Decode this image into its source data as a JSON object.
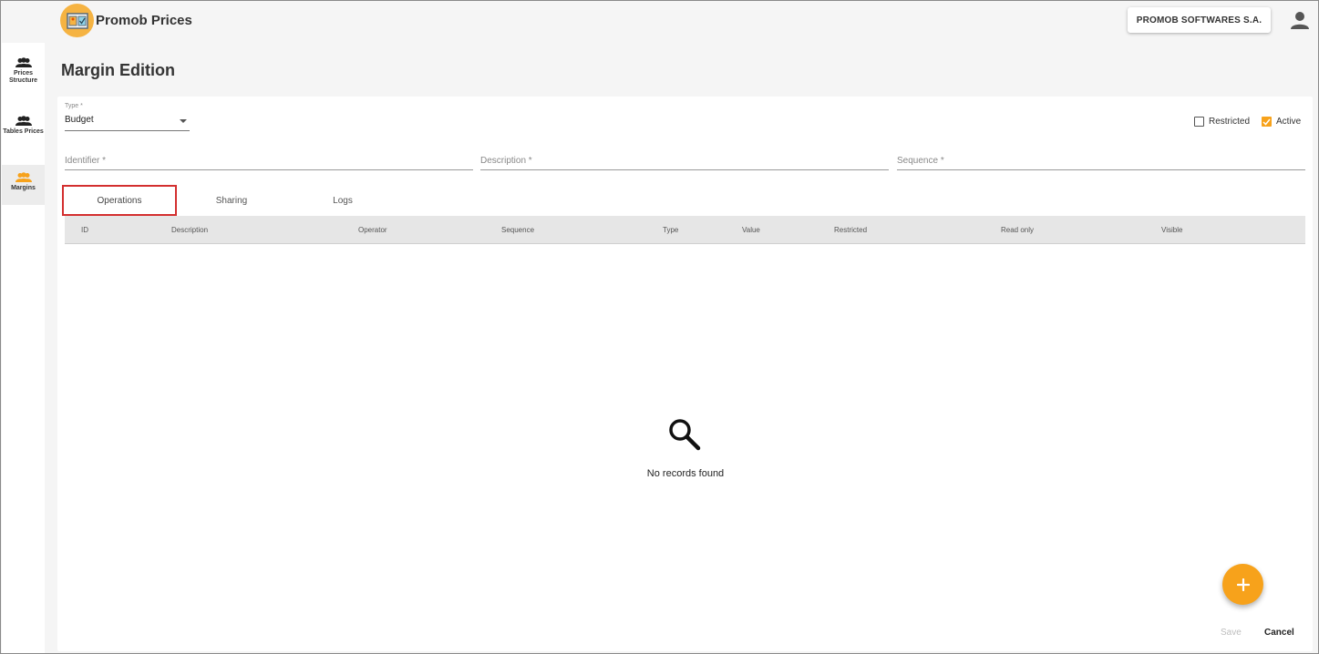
{
  "app": {
    "title": "Promob Prices",
    "company": "PROMOB SOFTWARES S.A."
  },
  "sidebar": {
    "items": [
      {
        "label_line1": "Prices",
        "label_line2": "Structure"
      },
      {
        "label_line1": "Tables Prices",
        "label_line2": ""
      },
      {
        "label_line1": "Margins",
        "label_line2": ""
      }
    ],
    "active_index": 2
  },
  "page": {
    "title": "Margin Edition"
  },
  "form": {
    "type_label": "Type *",
    "type_value": "Budget",
    "restricted_label": "Restricted",
    "restricted_checked": false,
    "active_label": "Active",
    "active_checked": true,
    "identifier_placeholder": "Identifier *",
    "description_placeholder": "Description *",
    "sequence_placeholder": "Sequence *"
  },
  "tabs": [
    {
      "label": "Operations",
      "selected": true
    },
    {
      "label": "Sharing",
      "selected": false
    },
    {
      "label": "Logs",
      "selected": false
    }
  ],
  "table": {
    "columns": [
      "ID",
      "Description",
      "Operator",
      "Sequence",
      "Type",
      "Value",
      "Restricted",
      "Read only",
      "Visible"
    ],
    "empty_message": "No records found"
  },
  "actions": {
    "save_label": "Save",
    "cancel_label": "Cancel"
  },
  "colors": {
    "accent": "#f7a21b",
    "selected_tab_border": "#d32f2f",
    "disabled_text": "#bdbdbd"
  }
}
